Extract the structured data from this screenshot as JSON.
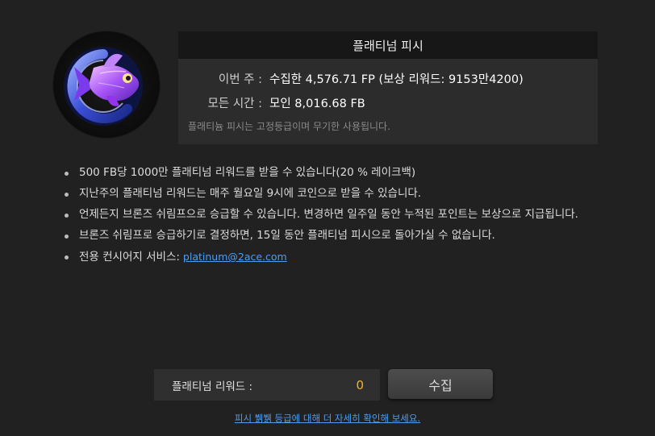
{
  "badge": {
    "icon": "platinum-fish-icon"
  },
  "panel": {
    "title": "플래티넘 피시",
    "week_label": "이번 주 :",
    "week_value": "수집한 4,576.71 FP (보상 리워드: 9153만4200)",
    "total_label": "모든 시간 :",
    "total_value": "모인 8,016.68 FB",
    "note": "플래티늄 피시는 고정등급이며 무기한 사용됩니다."
  },
  "bullets": [
    "500 FB당 1000만 플래티넘 리워드를 받을 수 있습니다(20 % 레이크백)",
    "지난주의 플래티넘 리워드는 매주 월요일 9시에 코인으로 받을 수 있습니다.",
    "언제든지 브론즈 쉬림프으로 승급할 수 있습니다. 변경하면 일주일 동안 누적된 포인트는 보상으로 지급됩니다.",
    "브론즈 쉬림프로 승급하기로 결정하면, 15일 동안 플래티넘 피시으로 돌아가실 수 없습니다.",
    "전용 컨시어지 서비스:"
  ],
  "concierge_email": "platinum@2ace.com",
  "reward": {
    "label": "플래티넘 리워드 :",
    "amount": "0"
  },
  "collect_label": "수집",
  "footer_link": "피시 뷁뷁 등급에 대해 더 자세히 확인해 보세요.",
  "colors": {
    "accent": "#f0b429",
    "link": "#4f9cf0",
    "background": "#212121"
  }
}
